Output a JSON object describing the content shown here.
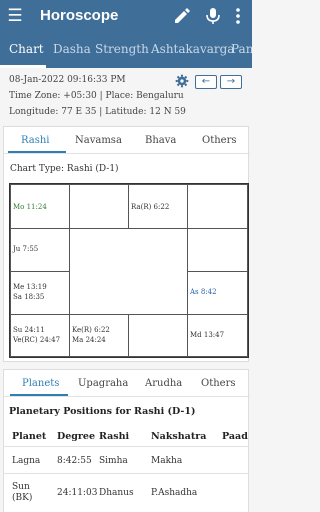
{
  "app": {
    "title": "Horoscope"
  },
  "tabs": [
    "Chart",
    "Dasha",
    "Strength",
    "Ashtakavarga",
    "Panc"
  ],
  "info": {
    "datetime": "08-Jan-2022 09:16:33 PM",
    "timezone_place": "Time Zone: +05:30  |  Place: Bengaluru",
    "lon_lat": "Longitude: 77 E 35  |  Latitude: 12 N 59"
  },
  "chart_tabs": [
    "Rashi",
    "Navamsa",
    "Bhava",
    "Others"
  ],
  "chart_type": "Chart Type: Rashi (D-1)",
  "grid": {
    "r0c0": "Mo 11:24",
    "r0c2": "Ra(R) 6:22",
    "r1c0": "Ju 7:55",
    "r2c0a": "Me 13:19",
    "r2c0b": "Sa 18:35",
    "r2c3": "As 8:42",
    "r3c0a": "Su 24:11",
    "r3c0b": "Ve(RC) 24:47",
    "r3c1a": "Ke(R) 6:22",
    "r3c1b": "Ma 24:24",
    "r3c3": "Md 13:47"
  },
  "planet_tabs": [
    "Planets",
    "Upagraha",
    "Arudha",
    "Others"
  ],
  "planet_section_title": "Planetary Positions for Rashi (D-1)",
  "planet_table": {
    "headers": [
      "Planet",
      "Degree",
      "Rashi",
      "Nakshatra",
      "Paad"
    ],
    "rows": [
      {
        "planet": "Lagna",
        "planet2": "",
        "degree": "8:42:55",
        "rashi": "Simha",
        "nakshatra": "Makha"
      },
      {
        "planet": "Sun",
        "planet2": "(BK)",
        "degree": "24:11:03",
        "rashi": "Dhanus",
        "nakshatra": "P.Ashadha"
      }
    ]
  },
  "colors": {
    "appbar": "#3f6e99",
    "accent": "#2f7fb4"
  }
}
